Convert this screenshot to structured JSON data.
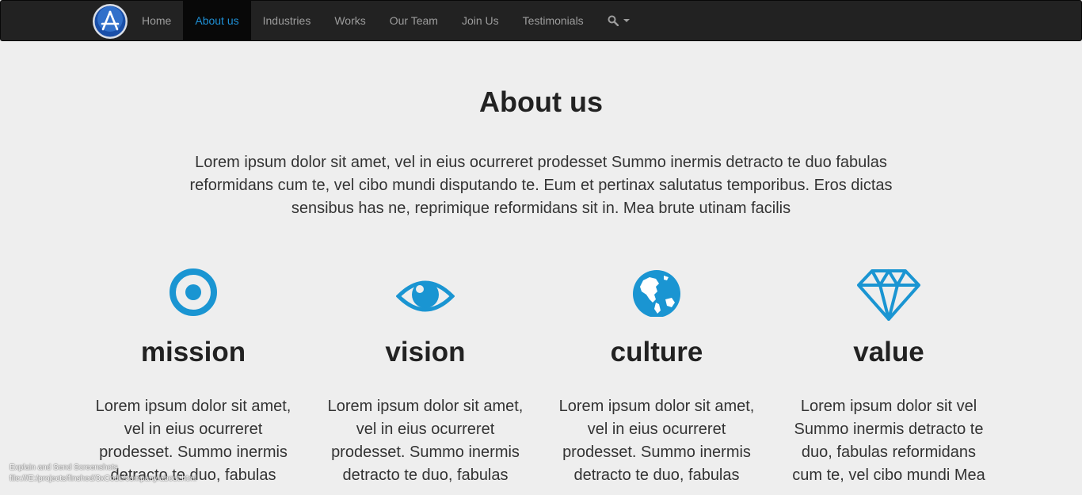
{
  "nav": {
    "items": [
      {
        "label": "Home"
      },
      {
        "label": "About us"
      },
      {
        "label": "Industries"
      },
      {
        "label": "Works"
      },
      {
        "label": "Our Team"
      },
      {
        "label": "Join Us"
      },
      {
        "label": "Testimonials"
      }
    ],
    "active": "About us",
    "search_icon": "search-icon"
  },
  "page": {
    "title": "About us",
    "intro": "Lorem ipsum dolor sit amet, vel in eius ocurreret prodesset Summo inermis detracto te duo fabulas reformidans cum te, vel cibo mundi disputando te. Eum et pertinax salutatus temporibus. Eros dictas sensibus has ne, reprimique reformidans sit in. Mea brute utinam facilis"
  },
  "features": [
    {
      "icon": "target-icon",
      "title": "mission",
      "text": "Lorem ipsum dolor sit amet, vel in eius ocurreret prodesset. Summo inermis detracto te duo, fabulas"
    },
    {
      "icon": "eye-icon",
      "title": "vision",
      "text": "Lorem ipsum dolor sit amet, vel in eius ocurreret prodesset. Summo inermis detracto te duo, fabulas"
    },
    {
      "icon": "globe-icon",
      "title": "culture",
      "text": "Lorem ipsum dolor sit amet, vel in eius ocurreret prodesset. Summo inermis detracto te duo, fabulas"
    },
    {
      "icon": "diamond-icon",
      "title": "value",
      "text": "Lorem ipsum dolor sit vel Summo inermis detracto te duo, fabulas reformidans cum te, vel cibo mundi Mea"
    }
  ],
  "overlay": {
    "line1": "Explain and Send Screenshots",
    "line2": "file:///E:/projects/finshed/3xCode/company/about.html"
  },
  "colors": {
    "accent": "#1e90d6",
    "icon": "#1a95d2",
    "navbar": "#222222"
  }
}
